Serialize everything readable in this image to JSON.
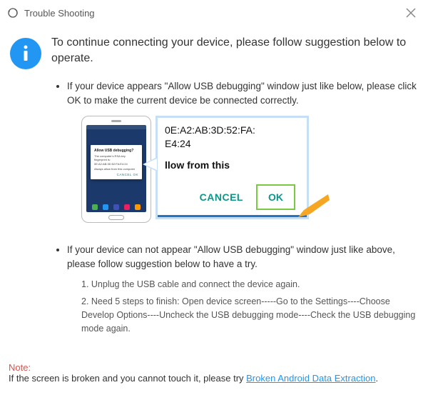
{
  "titlebar": {
    "title": "Trouble Shooting"
  },
  "headline": "To continue connecting your device, please follow suggestion below to operate.",
  "bullet1": "If your device appears \"Allow USB debugging\" window just like below, please click OK to make the current device  be connected correctly.",
  "bullet2": "If your device can not appear \"Allow USB debugging\" window just like above, please follow suggestion below to have a try.",
  "illustration": {
    "dialog_title": "Allow USB debugging?",
    "dialog_body": "The computer's RSA key fingerprint is: 0E:A2:AB:3D:52:FA:E4:24",
    "dialog_check": "Always allow from this computer",
    "dialog_actions": "CANCEL   OK",
    "zoom_mac1": "0E:A2:AB:3D:52:FA:",
    "zoom_mac2": "E4:24",
    "zoom_text": "llow from this",
    "zoom_cancel": "CANCEL",
    "zoom_ok": "OK"
  },
  "steps": {
    "s1": "1. Unplug the USB cable and connect the device again.",
    "s2": "2. Need 5 steps to finish: Open device screen-----Go to the Settings----Choose Develop Options----Uncheck the USB debugging mode----Check the USB debugging mode again."
  },
  "footer": {
    "note_label": "Note:",
    "text_before": "If the screen is broken and you cannot touch it, please try ",
    "link": "Broken Android Data Extraction",
    "text_after": "."
  }
}
